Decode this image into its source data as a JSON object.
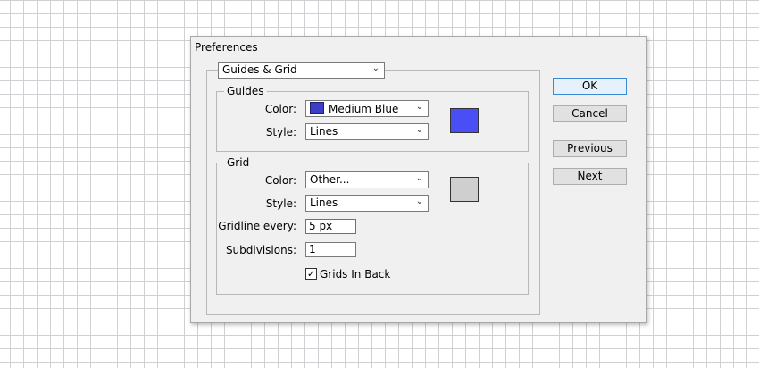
{
  "dialog": {
    "title": "Preferences",
    "section_select": "Guides & Grid"
  },
  "guides": {
    "legend": "Guides",
    "color_label": "Color:",
    "color_value": "Medium Blue",
    "color_hex": "#4a4ff5",
    "style_label": "Style:",
    "style_value": "Lines"
  },
  "grid": {
    "legend": "Grid",
    "color_label": "Color:",
    "color_value": "Other...",
    "color_hex": "#cfcfcf",
    "style_label": "Style:",
    "style_value": "Lines",
    "gridline_label": "Gridline every:",
    "gridline_value": "5 px",
    "subdivisions_label": "Subdivisions:",
    "subdivisions_value": "1",
    "grids_in_back_label": "Grids In Back",
    "grids_in_back_checked": true
  },
  "buttons": {
    "ok": "OK",
    "cancel": "Cancel",
    "previous": "Previous",
    "next": "Next"
  },
  "icons": {
    "dropdown_arrow": "chevron-down-icon",
    "check": "checkmark-icon"
  }
}
